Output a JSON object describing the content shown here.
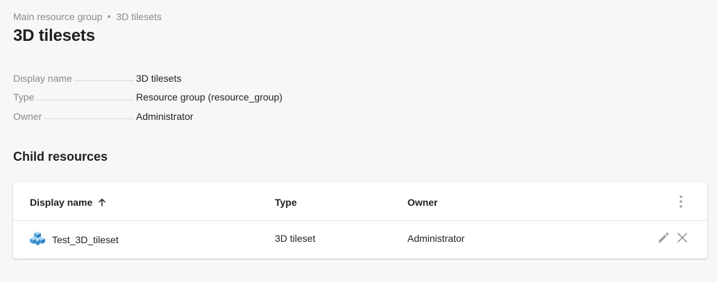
{
  "breadcrumb": {
    "items": [
      "Main resource group",
      "3D tilesets"
    ]
  },
  "page": {
    "title": "3D tilesets"
  },
  "properties": [
    {
      "key": "Display name",
      "value": "3D tilesets"
    },
    {
      "key": "Type",
      "value": "Resource group (resource_group)"
    },
    {
      "key": "Owner",
      "value": "Administrator"
    }
  ],
  "children": {
    "title": "Child resources",
    "columns": {
      "name": "Display name",
      "type": "Type",
      "owner": "Owner"
    },
    "sort": {
      "column": "Display name",
      "direction": "ascending",
      "icon": "arrow-up-icon"
    },
    "rows": [
      {
        "icon": "3d-tileset-icon",
        "name": "Test_3D_tileset",
        "type": "3D tileset",
        "owner": "Administrator",
        "actions": [
          "edit-icon",
          "delete-icon"
        ]
      }
    ]
  },
  "colors": {
    "background": "#f7f7f7",
    "muted_text": "#8a8a8a",
    "text": "#1f1f1f",
    "icon_gray": "#9e9e9e",
    "tileset_blue": "#4a9fdc"
  }
}
